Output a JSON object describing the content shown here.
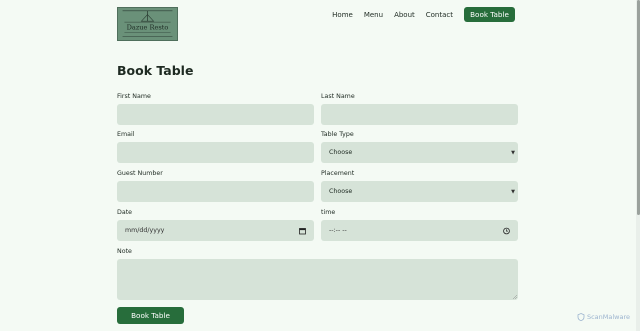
{
  "brand": {
    "logo_text": "Dazue Resto"
  },
  "nav": {
    "items": [
      {
        "label": "Home"
      },
      {
        "label": "Menu"
      },
      {
        "label": "About"
      },
      {
        "label": "Contact"
      }
    ],
    "cta_label": "Book Table"
  },
  "form": {
    "title": "Book Table",
    "first_name": {
      "label": "First Name",
      "value": ""
    },
    "last_name": {
      "label": "Last Name",
      "value": ""
    },
    "email": {
      "label": "Email",
      "value": ""
    },
    "table_type": {
      "label": "Table Type",
      "selected": "Choose"
    },
    "guest_number": {
      "label": "Guest Number",
      "value": ""
    },
    "placement": {
      "label": "Placement",
      "selected": "Choose"
    },
    "date": {
      "label": "Date",
      "placeholder": "mm/dd/yyyy"
    },
    "time": {
      "label": "time",
      "placeholder": "--:-- --"
    },
    "note": {
      "label": "Note",
      "value": ""
    },
    "submit_label": "Book Table"
  },
  "watermark": {
    "text": "ScanMalware"
  },
  "colors": {
    "background": "#f4faf4",
    "field": "#d6e3d8",
    "accent": "#276d3b"
  }
}
